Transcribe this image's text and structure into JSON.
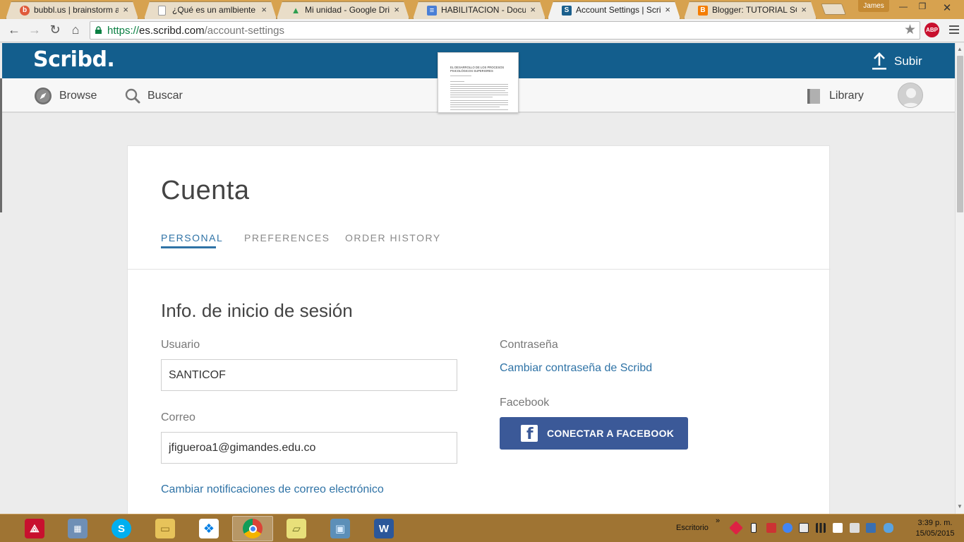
{
  "browser": {
    "tabs": [
      {
        "title": "bubbl.us | brainstorm and",
        "favicon_color": "#e05a3a",
        "favicon_glyph": "b",
        "active": false
      },
      {
        "title": "¿Qué es un amlbiente virt",
        "favicon_color": "#bbbbbb",
        "favicon_glyph": "",
        "active": false
      },
      {
        "title": "Mi unidad - Google Drive",
        "favicon_color": "#2e9e4f",
        "favicon_glyph": "▲",
        "active": false
      },
      {
        "title": "HABILITACION - Documen",
        "favicon_color": "#4a7fd6",
        "favicon_glyph": "≡",
        "active": false
      },
      {
        "title": "Account Settings | Scribd",
        "favicon_color": "#1a5f8d",
        "favicon_glyph": "S",
        "active": true
      },
      {
        "title": "Blogger: TUTORIAL SCRIB",
        "favicon_color": "#f57d00",
        "favicon_glyph": "B",
        "active": false
      }
    ],
    "user_badge": "James",
    "url": {
      "scheme": "https://",
      "host": "es.scribd.com",
      "path": "/account-settings"
    },
    "abp_label": "ABP"
  },
  "scribd": {
    "logo": "Scribd.",
    "upload_label": "Subir",
    "nav": {
      "browse": "Browse",
      "search": "Buscar",
      "library": "Library"
    },
    "doc_thumbnail": {
      "title": "EL DESARROLLO DE LOS PROCESOS PSICOLÓGICOS SUPERIORES"
    }
  },
  "settings": {
    "page_title": "Cuenta",
    "tabs": [
      {
        "label": "PERSONAL",
        "active": true
      },
      {
        "label": "PREFERENCES",
        "active": false
      },
      {
        "label": "ORDER HISTORY",
        "active": false
      }
    ],
    "section_title": "Info. de inicio de sesión",
    "username_label": "Usuario",
    "username_value": "SANTICOF",
    "email_label": "Correo",
    "email_value": "jfigueroa1@gimandes.edu.co",
    "email_notifications_link": "Cambiar notificaciones de correo electrónico",
    "password_label": "Contraseña",
    "password_link": "Cambiar contraseña de Scribd",
    "facebook_label": "Facebook",
    "facebook_button": "CONECTAR A FACEBOOK"
  },
  "taskbar": {
    "desktop_label": "Escritorio",
    "chevron": "»",
    "time": "3:39 p. m.",
    "date": "15/05/2015"
  },
  "colors": {
    "scribd_blue": "#135e8d",
    "link_blue": "#2f73a6",
    "facebook_blue": "#3b5998",
    "chrome_frame": "#d7a24f",
    "taskbar": "#9f7433"
  }
}
